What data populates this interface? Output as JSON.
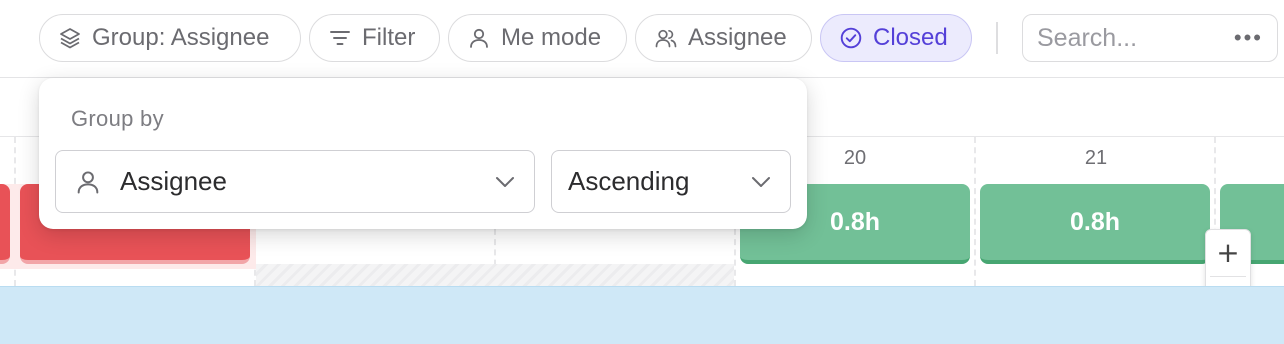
{
  "toolbar": {
    "group_label": "Group: Assignee",
    "filter_label": "Filter",
    "me_mode_label": "Me mode",
    "assignee_label": "Assignee",
    "closed_label": "Closed",
    "search_placeholder": "Search...",
    "more_label": "•••"
  },
  "timeline": {
    "days": [
      "20",
      "21"
    ],
    "bars": [
      {
        "label": "",
        "color": "red"
      },
      {
        "label": "",
        "color": "red"
      },
      {
        "label": "0.8h",
        "color": "green"
      },
      {
        "label": "0.8h",
        "color": "green"
      },
      {
        "label": "",
        "color": "green"
      }
    ],
    "zoom_in": "+",
    "zoom_out": "−"
  },
  "popover": {
    "title": "Group by",
    "group_value": "Assignee",
    "order_value": "Ascending"
  },
  "colors": {
    "accent": "#5440d8",
    "accent_bg": "#ecebfd",
    "bar_green": "#72c097",
    "bar_red": "#e85257",
    "bottom_band": "#cfe8f7"
  }
}
